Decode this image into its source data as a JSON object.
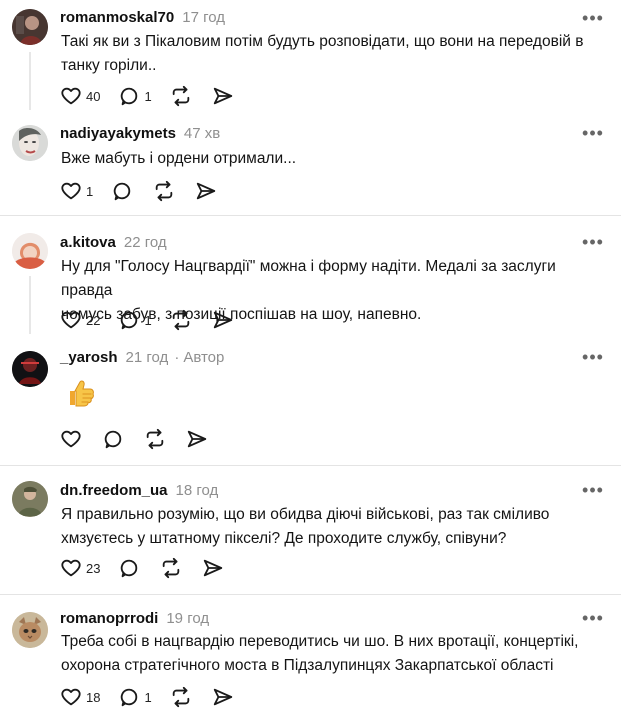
{
  "colors": {
    "text": "#101010",
    "muted": "#8f8f8f",
    "divider": "#e4e4e4",
    "thread_line": "#e7e7e7"
  },
  "icons": {
    "more": "ellipsis-horizontal-icon",
    "like": "heart-outline-icon",
    "reply": "speech-bubble-icon",
    "repost": "repost-arrows-icon",
    "share": "paper-plane-icon"
  },
  "comments": [
    {
      "username": "romanmoskal70",
      "time": "17 год",
      "text_lines": [
        "Такі як ви з Пікаловим потім будуть розповідати, що вони на передовій в",
        "танку горіли.."
      ],
      "likes": "40",
      "replies": "1"
    },
    {
      "username": "nadiyayakymets",
      "time": "47 хв",
      "text_lines": [
        "Вже мабуть і ордени отримали..."
      ],
      "likes": "1",
      "replies": ""
    },
    {
      "username": "a.kitova",
      "time": "22 год",
      "text_lines": [
        "Ну для \"Голосу Нацгвардії\" можна і форму надіти. Медалі за заслуги правда",
        "чомусь забув, з позиції поспішав на шоу, напевно."
      ],
      "likes": "22",
      "replies": "1"
    },
    {
      "username": "_yarosh",
      "time": "21 год",
      "author_separator": "·",
      "author_label": "Автор",
      "reaction": "thumbs-up-emoji",
      "likes": "",
      "replies": ""
    },
    {
      "username": "dn.freedom_ua",
      "time": "18 год",
      "text_lines": [
        "Я правильно розумію, що ви обидва діючі військові, раз так сміливо",
        "хмзуєтесь у штатному пікселі? Де проходите службу, співуни?"
      ],
      "likes": "23",
      "replies": ""
    },
    {
      "username": "romanoprrodi",
      "time": "19 год",
      "text_lines": [
        "Треба собі в нацгвардію переводитись чи шо. В них вротації, концертікі,",
        "охорона стратегічного моста в Підзалупинцях Закарпатської області"
      ],
      "likes": "18",
      "replies": "1"
    }
  ]
}
